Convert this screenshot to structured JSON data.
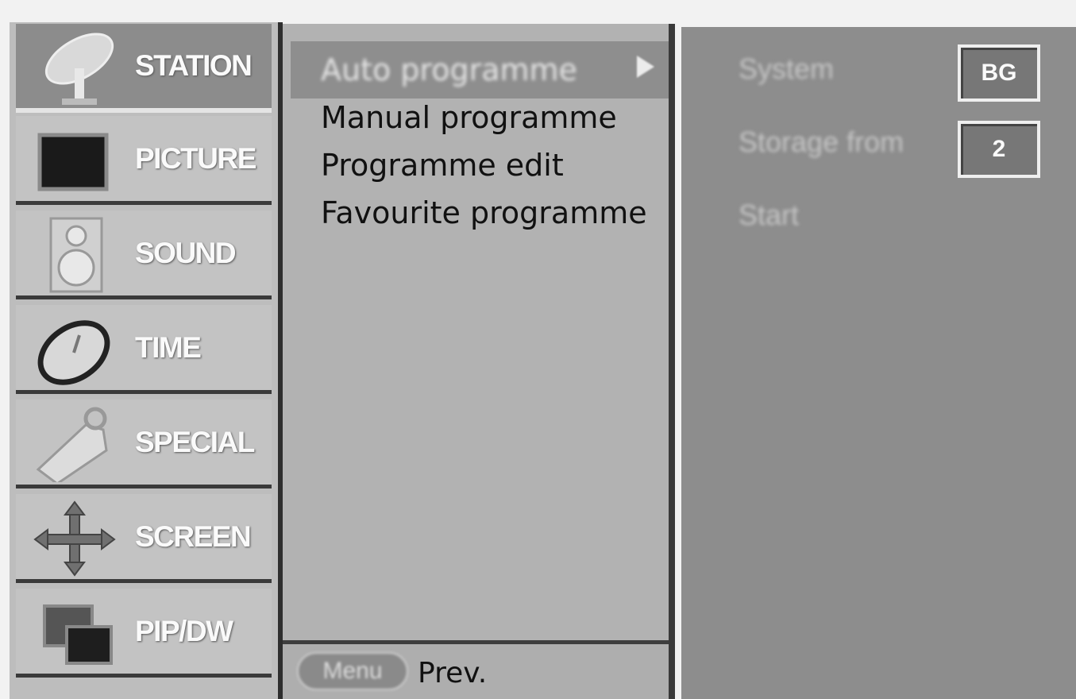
{
  "menu": {
    "categories": [
      {
        "label": "STATION",
        "icon": "satellite-dish-icon",
        "active": true
      },
      {
        "label": "PICTURE",
        "icon": "screen-icon",
        "active": false
      },
      {
        "label": "SOUND",
        "icon": "speaker-icon",
        "active": false
      },
      {
        "label": "TIME",
        "icon": "clock-icon",
        "active": false
      },
      {
        "label": "SPECIAL",
        "icon": "tag-icon",
        "active": false
      },
      {
        "label": "SCREEN",
        "icon": "move-arrows-icon",
        "active": false
      },
      {
        "label": "PIP/DW",
        "icon": "pip-windows-icon",
        "active": false
      }
    ]
  },
  "submenu": {
    "items": [
      {
        "label": "Auto programme",
        "active": true
      },
      {
        "label": "Manual programme",
        "active": false
      },
      {
        "label": "Programme edit",
        "active": false
      },
      {
        "label": "Favourite programme",
        "active": false
      }
    ],
    "footer": {
      "menu_button": "Menu",
      "prev_label": "Prev."
    }
  },
  "options": {
    "items": [
      {
        "label": "System",
        "value": "BG"
      },
      {
        "label": "Storage from",
        "value": "2"
      },
      {
        "label": "Start",
        "value": ""
      }
    ]
  },
  "colors": {
    "panel_dark": "#8d8d8d",
    "panel_light": "#b2b2b2",
    "text_dark": "#111111",
    "text_light": "#fafafa"
  }
}
